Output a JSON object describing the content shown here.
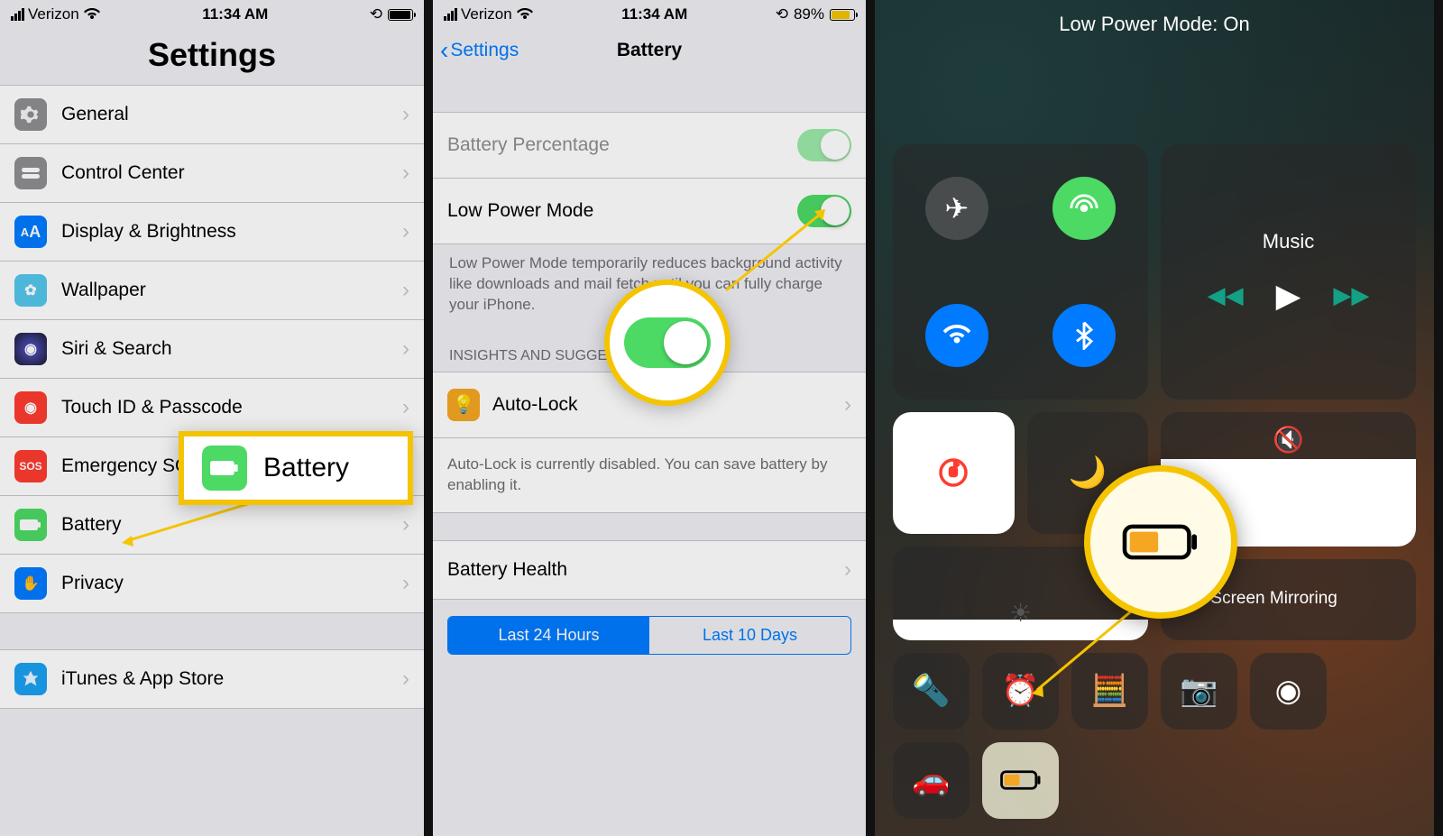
{
  "statusbar": {
    "carrier": "Verizon",
    "time": "11:34 AM",
    "battery_pct": "89%"
  },
  "p1": {
    "title": "Settings",
    "group1": [
      {
        "label": "General",
        "color": "#8e8e93"
      },
      {
        "label": "Control Center",
        "color": "#8e8e93"
      },
      {
        "label": "Display & Brightness",
        "color": "#007aff",
        "code": "AA"
      },
      {
        "label": "Wallpaper",
        "color": "#54c7ec"
      },
      {
        "label": "Siri & Search",
        "color": "#1a1a2e"
      },
      {
        "label": "Touch ID & Passcode",
        "color": "#ff3b30"
      },
      {
        "label": "Emergency SOS",
        "color": "#ff3b30",
        "code": "SOS"
      },
      {
        "label": "Battery",
        "color": "#4cd964"
      },
      {
        "label": "Privacy",
        "color": "#007aff"
      }
    ],
    "group2": [
      {
        "label": "iTunes & App Store",
        "color": "#1ba1f2"
      }
    ]
  },
  "callout1": {
    "label": "Battery"
  },
  "p2": {
    "back": "Settings",
    "title": "Battery",
    "row_percentage": "Battery Percentage",
    "row_lowpower": "Low Power Mode",
    "footer_lowpower": "Low Power Mode temporarily reduces background activity like downloads and mail fetch until you can fully charge your iPhone.",
    "section_header": "INSIGHTS AND SUGGESTIONS",
    "row_autolock": "Auto-Lock",
    "footer_autolock": "Auto-Lock is currently disabled. You can save battery by enabling it.",
    "row_health": "Battery Health",
    "seg_left": "Last 24 Hours",
    "seg_right": "Last 10 Days"
  },
  "p3": {
    "status": "Low Power Mode: On",
    "music": "Music",
    "mirror": "Screen Mirroring"
  }
}
